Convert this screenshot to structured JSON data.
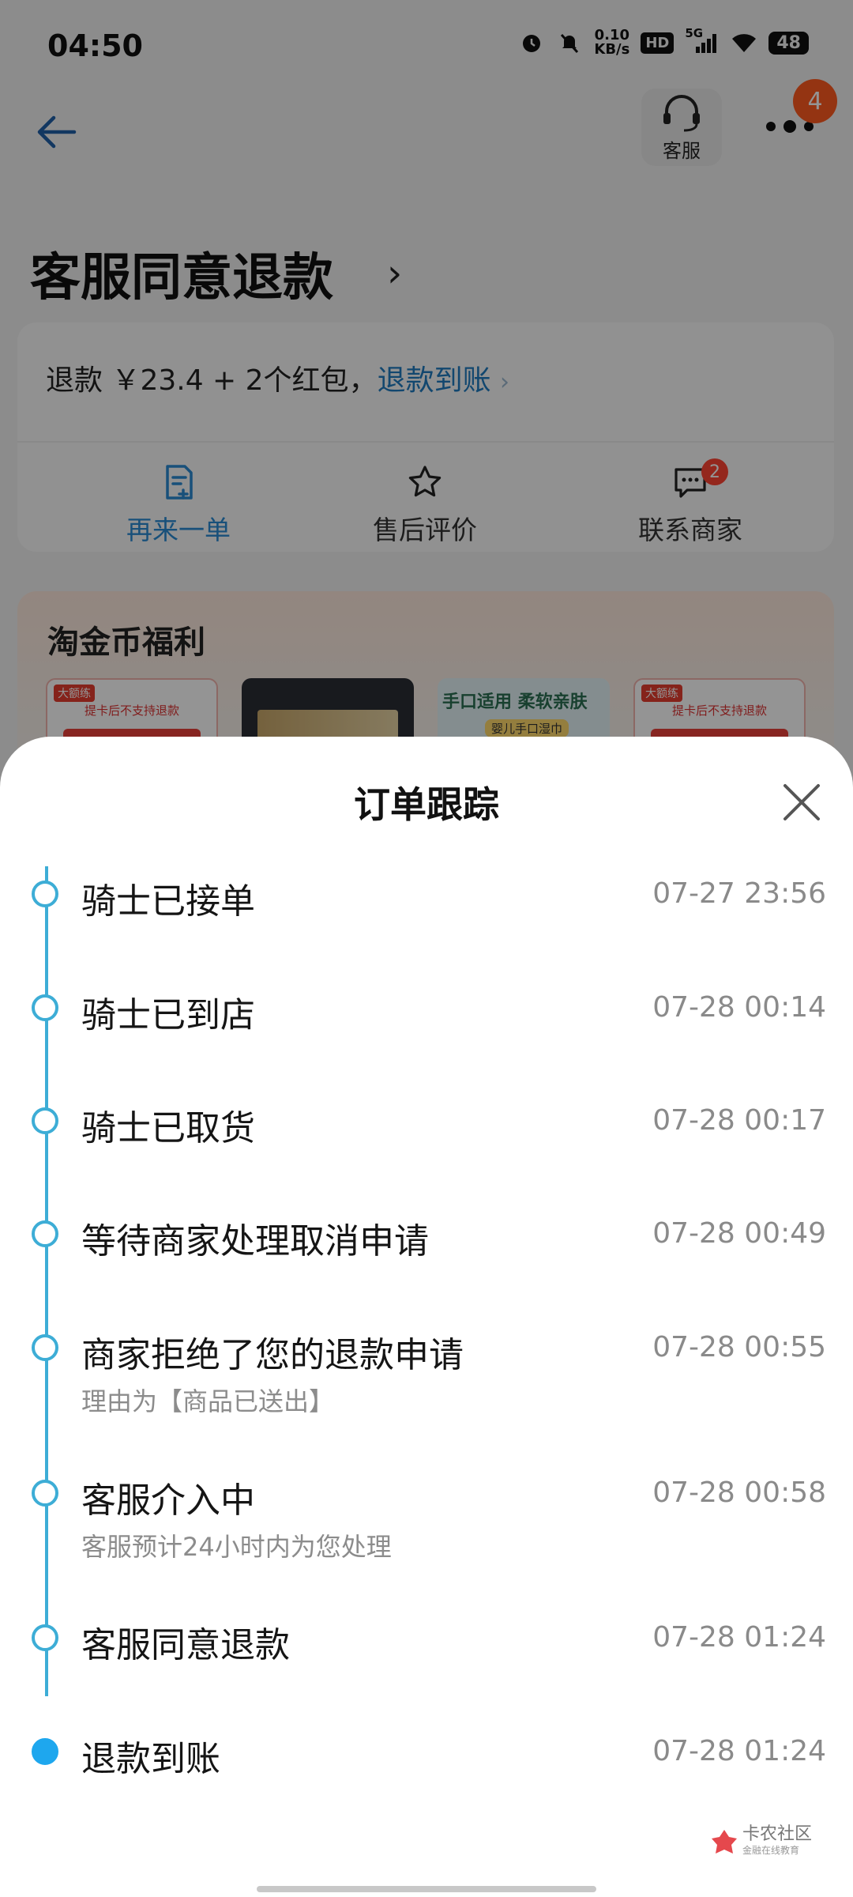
{
  "status_bar": {
    "time": "04:50",
    "net_speed_value": "0.10",
    "net_speed_unit": "KB/s",
    "hd": "HD",
    "signal": "5G",
    "battery": "48"
  },
  "header": {
    "cs_label": "客服",
    "more_badge": "4"
  },
  "page_title": "客服同意退款",
  "refund": {
    "text": "退款 ￥23.4 + 2个红包，",
    "link": "退款到账"
  },
  "actions": [
    {
      "label": "再来一单"
    },
    {
      "label": "售后评价"
    },
    {
      "label": "联系商家",
      "badge": "2"
    }
  ],
  "benefits": {
    "title": "淘金币福利",
    "thumbs": [
      {
        "tag": "大额练",
        "text": "提卡后不支持退款"
      },
      {
        "tag": "",
        "text": ""
      },
      {
        "text": "手口适用 柔软亲肤",
        "sub": "婴儿手口湿巾"
      },
      {
        "tag": "大额练",
        "text": "提卡后不支持退款"
      }
    ]
  },
  "sheet": {
    "title": "订单跟踪",
    "events": [
      {
        "title": "骑士已接单",
        "time": "07-27 23:56",
        "sub": ""
      },
      {
        "title": "骑士已到店",
        "time": "07-28 00:14",
        "sub": ""
      },
      {
        "title": "骑士已取货",
        "time": "07-28 00:17",
        "sub": ""
      },
      {
        "title": "等待商家处理取消申请",
        "time": "07-28 00:49",
        "sub": ""
      },
      {
        "title": "商家拒绝了您的退款申请",
        "time": "07-28 00:55",
        "sub": "理由为【商品已送出】"
      },
      {
        "title": "客服介入中",
        "time": "07-28 00:58",
        "sub": "客服预计24小时内为您处理"
      },
      {
        "title": "客服同意退款",
        "time": "07-28 01:24",
        "sub": ""
      },
      {
        "title": "退款到账",
        "time": "07-28 01:24",
        "sub": ""
      }
    ]
  },
  "watermark": {
    "name": "卡农社区",
    "sub": "金融在线教育"
  },
  "colors": {
    "timeline": "#3dadd6",
    "final_dot": "#1ea7ee",
    "link": "#1f7bbf",
    "badge": "#ff5a1f"
  }
}
